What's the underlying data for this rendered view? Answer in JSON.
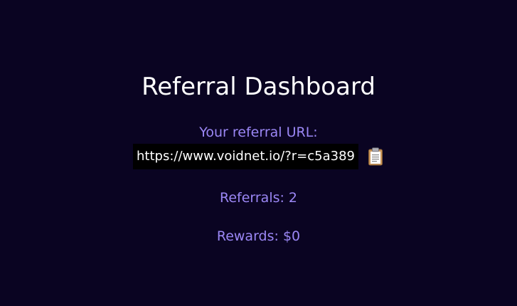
{
  "page": {
    "title": "Referral Dashboard"
  },
  "referral": {
    "url_label": "Your referral URL:",
    "url": "https://www.voidnet.io/?r=c5a389",
    "copy_icon": "clipboard-icon"
  },
  "stats": {
    "referrals": "Referrals: 2",
    "rewards": "Rewards: $0"
  },
  "colors": {
    "background": "#0a0422",
    "accent": "#9b87f5",
    "title": "#ffffff",
    "url_box": "#000000"
  }
}
